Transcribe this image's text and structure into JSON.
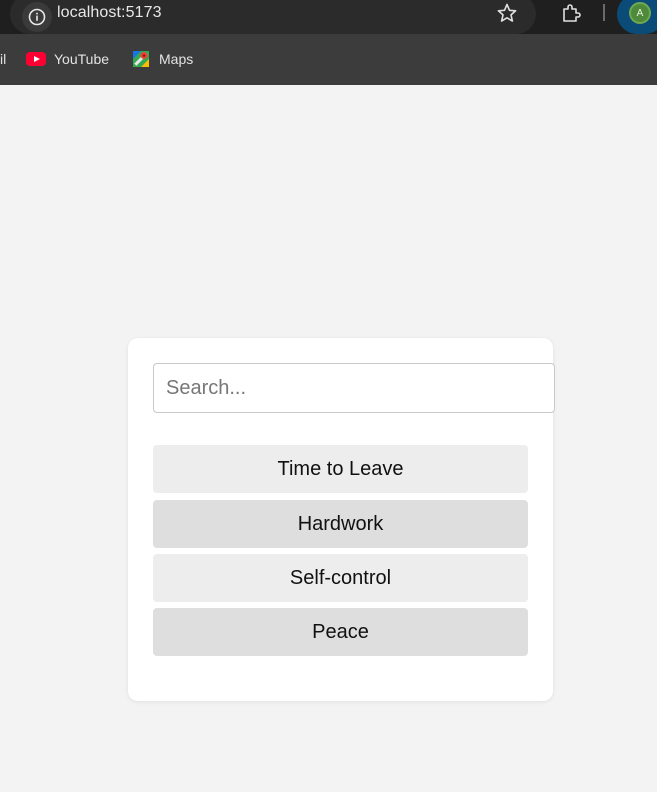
{
  "browser": {
    "url": "localhost:5173",
    "profile_initial": "A",
    "bookmarks": {
      "cut_label": "il",
      "items": [
        {
          "label": "YouTube",
          "icon": "youtube-icon"
        },
        {
          "label": "Maps",
          "icon": "maps-icon"
        }
      ]
    }
  },
  "app": {
    "search": {
      "placeholder": "Search...",
      "value": ""
    },
    "items": [
      {
        "label": "Time to Leave"
      },
      {
        "label": "Hardwork"
      },
      {
        "label": "Self-control"
      },
      {
        "label": "Peace"
      }
    ]
  },
  "colors": {
    "page_background": "#f3f3f3",
    "card_background": "#ffffff",
    "item_light": "#ededed",
    "item_dark": "#dedede",
    "browser_toolbar": "#1f1f1f",
    "bookmark_bar": "#3c3c3c",
    "youtube_red": "#ff0033"
  }
}
